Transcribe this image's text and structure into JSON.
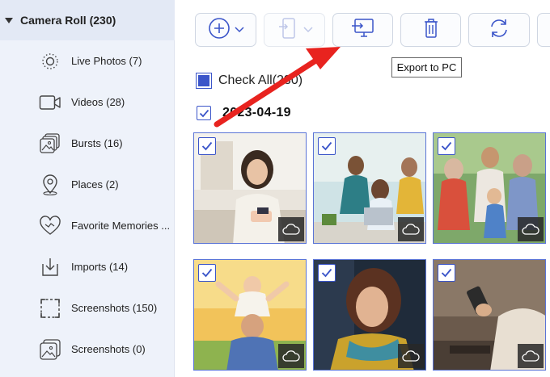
{
  "sidebar": {
    "group_title": "Camera Roll (230)",
    "items": [
      {
        "label": "Live Photos (7)",
        "icon": "live-photo-icon"
      },
      {
        "label": "Videos (28)",
        "icon": "video-icon"
      },
      {
        "label": "Bursts (16)",
        "icon": "bursts-icon"
      },
      {
        "label": "Places (2)",
        "icon": "places-icon"
      },
      {
        "label": "Favorite Memories ...",
        "icon": "heart-icon"
      },
      {
        "label": "Imports (14)",
        "icon": "import-icon"
      },
      {
        "label": "Screenshots (150)",
        "icon": "screenshot-icon"
      },
      {
        "label": "Screenshots (0)",
        "icon": "screenshots-album-icon"
      }
    ]
  },
  "toolbar": {
    "buttons": [
      {
        "name": "add",
        "icon": "add-icon"
      },
      {
        "name": "transfer-to-device",
        "icon": "phone-transfer-icon"
      },
      {
        "name": "export-to-pc",
        "icon": "monitor-export-icon"
      },
      {
        "name": "delete",
        "icon": "trash-icon"
      },
      {
        "name": "refresh",
        "icon": "refresh-icon"
      }
    ],
    "tooltip": "Export to PC"
  },
  "main": {
    "check_all_label": "Check All(230)",
    "date_group": "2023-04-19"
  },
  "colors": {
    "accent": "#3b55c9",
    "arrow": "#e8231f",
    "sidebar_bg": "#eef2fa"
  }
}
